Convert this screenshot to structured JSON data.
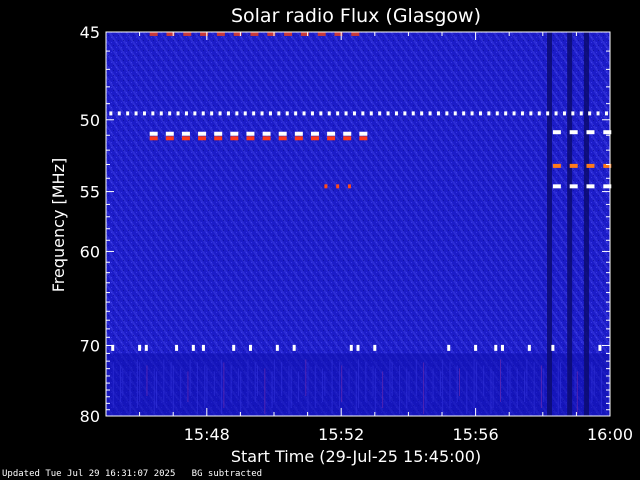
{
  "chart_data": {
    "type": "heatmap",
    "title": "Solar radio Flux (Glasgow)",
    "xlabel": "Start Time (29-Jul-25 15:45:00)",
    "ylabel": "Frequency [MHz]",
    "x_ticks": [
      "15:48",
      "15:52",
      "15:56",
      "16:00"
    ],
    "x_tick_minutes": [
      3,
      7,
      11,
      15
    ],
    "xlim_minutes": [
      0,
      15
    ],
    "y_ticks": [
      45,
      50,
      55,
      60,
      70,
      80
    ],
    "ylim_mhz": [
      45,
      80
    ],
    "y_scale": "reciprocal",
    "background_color": "#1c1cc8",
    "interference_bands": [
      {
        "freq_mhz": 49.6,
        "start_min": 0.1,
        "end_min": 15,
        "color": "#ffffff",
        "spacing_min": 0.25
      },
      {
        "freq_mhz": 50.9,
        "start_min": 1.3,
        "end_min": 8.0,
        "color": "#ffffff",
        "spacing_min": 0.48
      },
      {
        "freq_mhz": 51.2,
        "start_min": 1.3,
        "end_min": 8.0,
        "color": "#ff3a1a",
        "spacing_min": 0.48
      },
      {
        "freq_mhz": 50.8,
        "start_min": 13.3,
        "end_min": 15,
        "color": "#ffffff",
        "spacing_min": 0.5
      },
      {
        "freq_mhz": 53.1,
        "start_min": 13.3,
        "end_min": 15,
        "color": "#ff7a1a",
        "spacing_min": 0.5
      },
      {
        "freq_mhz": 54.6,
        "start_min": 13.3,
        "end_min": 15,
        "color": "#ffffff",
        "spacing_min": 0.5
      },
      {
        "freq_mhz": 54.6,
        "start_min": 6.5,
        "end_min": 7.4,
        "color": "#ff4a1a",
        "spacing_min": 0.35
      },
      {
        "freq_mhz": 45.1,
        "start_min": 1.3,
        "end_min": 7.7,
        "color": "#c83a3a",
        "spacing_min": 0.5
      }
    ],
    "bright_spots": [
      {
        "freq_mhz": 70.3,
        "min": 0.2
      },
      {
        "freq_mhz": 70.3,
        "min": 1.0
      },
      {
        "freq_mhz": 70.3,
        "min": 1.2
      },
      {
        "freq_mhz": 70.3,
        "min": 2.1
      },
      {
        "freq_mhz": 70.3,
        "min": 2.6
      },
      {
        "freq_mhz": 70.3,
        "min": 2.9
      },
      {
        "freq_mhz": 70.3,
        "min": 3.8
      },
      {
        "freq_mhz": 70.3,
        "min": 4.3
      },
      {
        "freq_mhz": 70.3,
        "min": 5.1
      },
      {
        "freq_mhz": 70.3,
        "min": 5.6
      },
      {
        "freq_mhz": 70.3,
        "min": 7.3
      },
      {
        "freq_mhz": 70.3,
        "min": 7.5
      },
      {
        "freq_mhz": 70.3,
        "min": 8.0
      },
      {
        "freq_mhz": 70.3,
        "min": 10.2
      },
      {
        "freq_mhz": 70.3,
        "min": 11.0
      },
      {
        "freq_mhz": 70.3,
        "min": 11.6
      },
      {
        "freq_mhz": 70.3,
        "min": 11.8
      },
      {
        "freq_mhz": 70.3,
        "min": 12.6
      },
      {
        "freq_mhz": 70.3,
        "min": 13.3
      },
      {
        "freq_mhz": 70.3,
        "min": 14.7
      }
    ],
    "dark_columns_min": [
      13.2,
      13.8,
      14.3
    ]
  },
  "footer": {
    "updated": "Updated Tue Jul 29 16:31:07 2025   BG subtracted"
  }
}
